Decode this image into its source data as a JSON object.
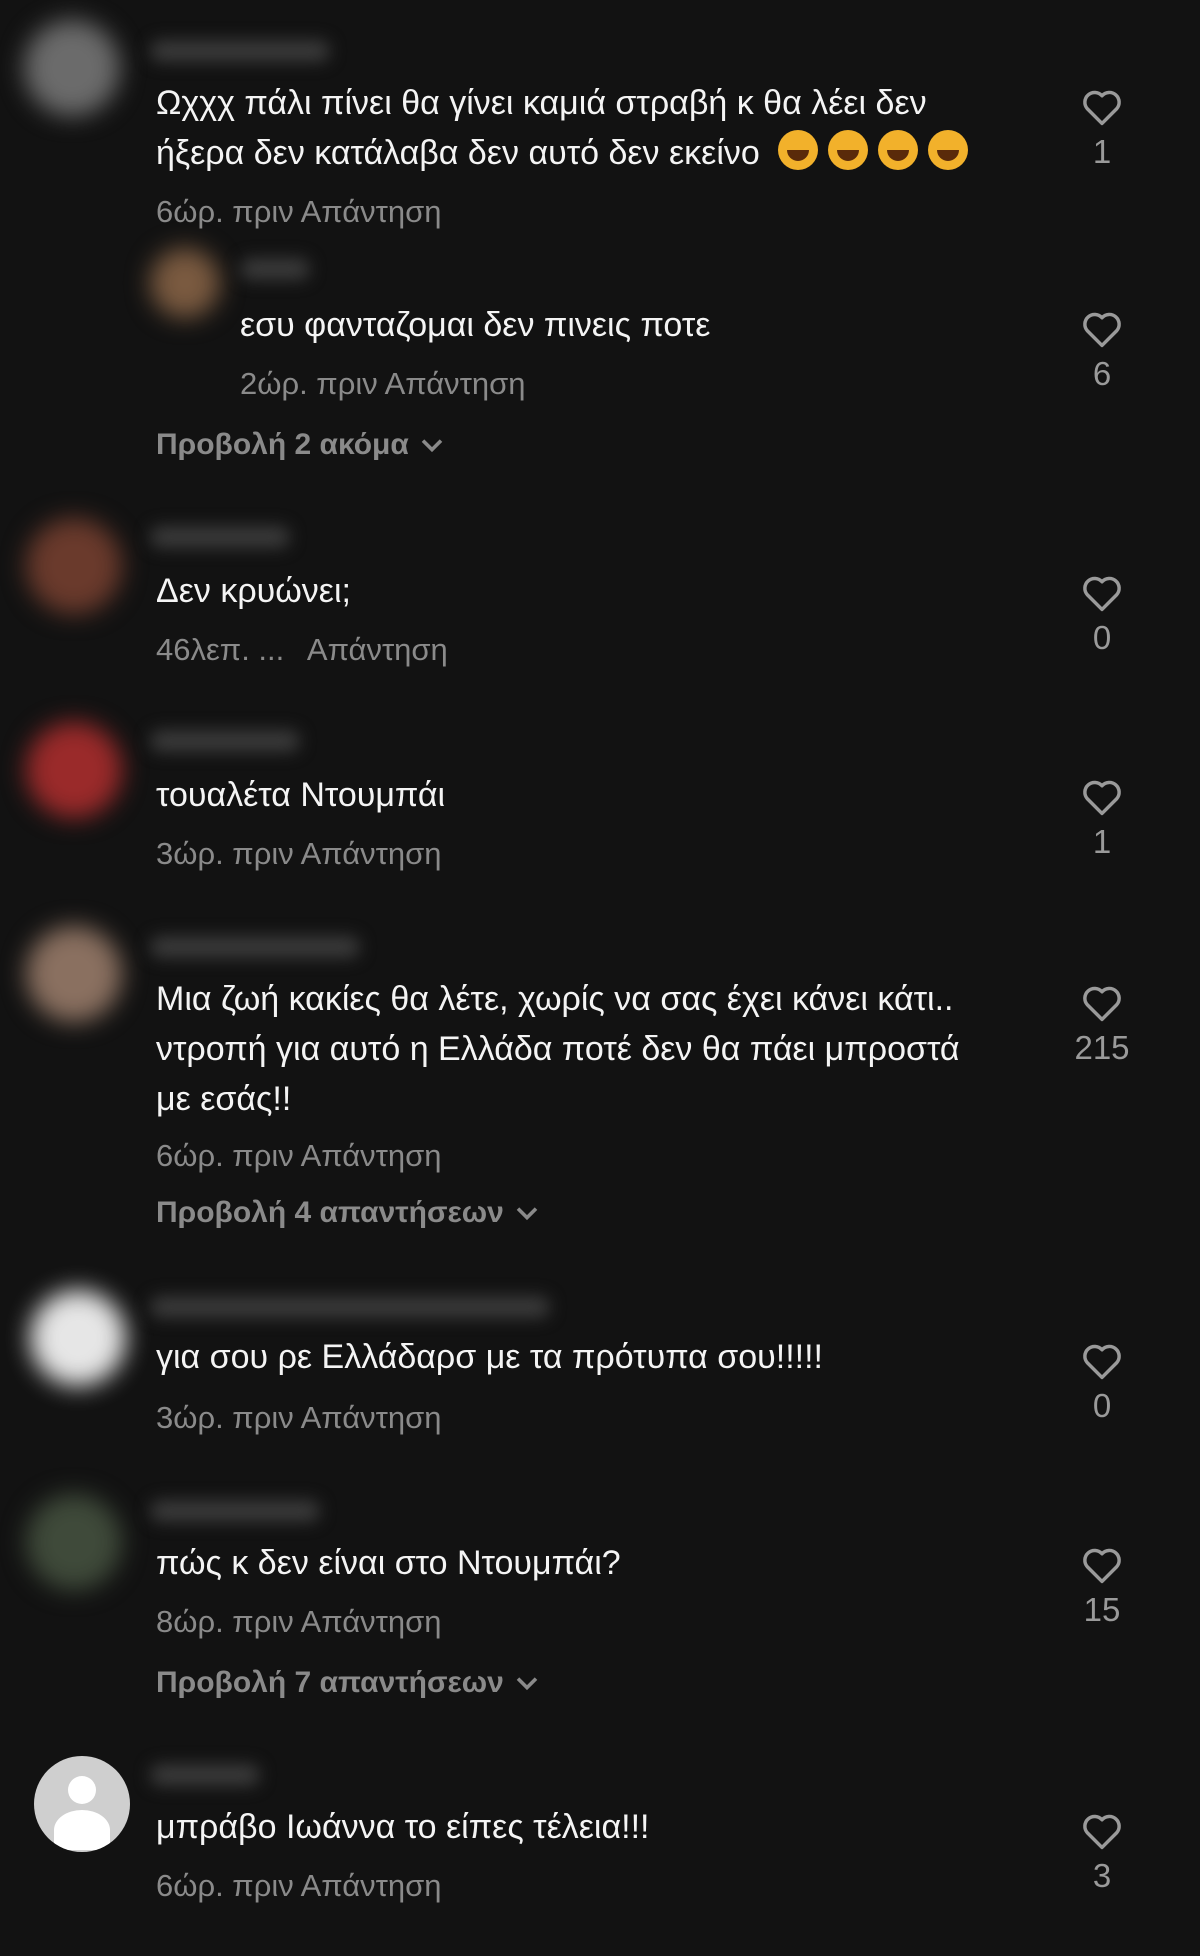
{
  "comments": [
    {
      "text_lines": [
        "Ωχχχ πάλι πίνει θα γίνει καμιά στραβή κ θα λέει δεν",
        "ήξερα δεν κατάλαβα δεν αυτό δεν εκείνο"
      ],
      "emojis": [
        "rolling-on-floor-laughing-emoji",
        "rolling-on-floor-laughing-emoji",
        "rolling-on-floor-laughing-emoji",
        "rolling-on-floor-laughing-emoji"
      ],
      "time": "6ώρ. πριν",
      "reply": "Απάντηση",
      "likes": "1"
    },
    {
      "text_lines": [
        "εσυ φανταζομαι δεν πινεις ποτε"
      ],
      "time": "2ώρ. πριν",
      "reply": "Απάντηση",
      "likes": "6",
      "is_reply": true
    },
    {
      "text_lines": [
        "Δεν κρυώνει;"
      ],
      "time": "46λεπ. ...",
      "reply": "Απάντηση",
      "likes": "0"
    },
    {
      "text_lines": [
        "τουαλέτα Ντουμπάι"
      ],
      "time": "3ώρ. πριν",
      "reply": "Απάντηση",
      "likes": "1"
    },
    {
      "text_lines": [
        "Μια ζωή κακίες θα λέτε, χωρίς να σας έχει κάνει κάτι..",
        "ντροπή για αυτό η Ελλάδα ποτέ δεν θα πάει μπροστά",
        "με εσάς!!"
      ],
      "time": "6ώρ. πριν",
      "reply": "Απάντηση",
      "likes": "215"
    },
    {
      "text_lines": [
        "για σου ρε Ελλάδαρσ με τα πρότυπα σου!!!!!"
      ],
      "time": "3ώρ. πριν",
      "reply": "Απάντηση",
      "likes": "0"
    },
    {
      "text_lines": [
        "πώς κ δεν είναι στο Ντουμπάι?"
      ],
      "time": "8ώρ. πριν",
      "reply": "Απάντηση",
      "likes": "15"
    },
    {
      "text_lines": [
        "μπράβο Ιωάννα το είπες τέλεια!!!"
      ],
      "time": "6ώρ. πριν",
      "reply": "Απάντηση",
      "likes": "3"
    }
  ],
  "view_more": [
    {
      "label": "Προβολή 2 ακόμα"
    },
    {
      "label": "Προβολή 4 απαντήσεων"
    },
    {
      "label": "Προβολή 7 απαντήσεων"
    }
  ],
  "icons": {
    "like": "heart-outline-icon",
    "expand": "chevron-down-icon"
  },
  "colors": {
    "background": "#121212",
    "text": "#f4f4f4",
    "muted": "#8a8a8a"
  }
}
